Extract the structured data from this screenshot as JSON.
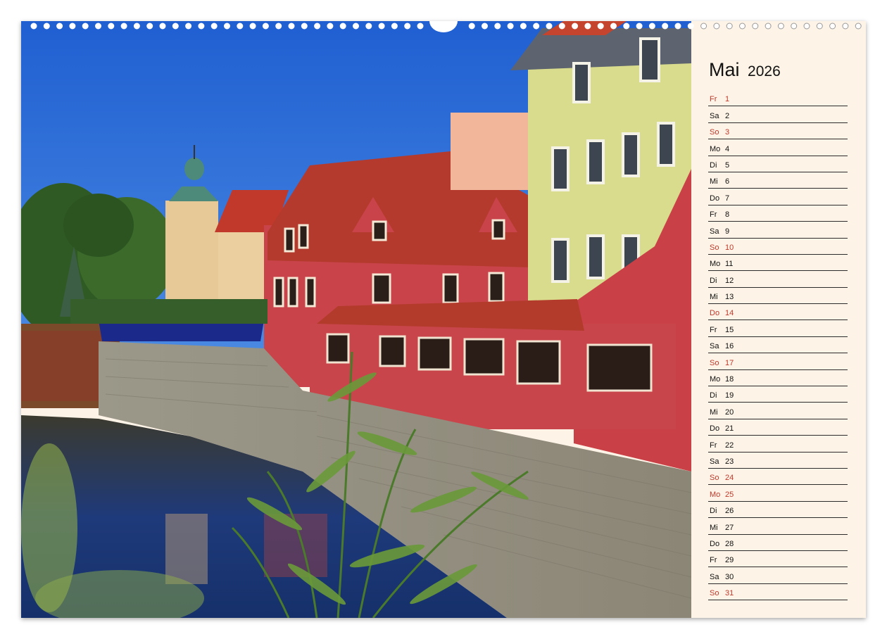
{
  "calendar": {
    "month": "Mai",
    "year": "2026",
    "holiday_color": "#c0392b",
    "days": [
      {
        "wd": "Fr",
        "num": "1",
        "holiday": true
      },
      {
        "wd": "Sa",
        "num": "2",
        "holiday": false
      },
      {
        "wd": "So",
        "num": "3",
        "holiday": true
      },
      {
        "wd": "Mo",
        "num": "4",
        "holiday": false
      },
      {
        "wd": "Di",
        "num": "5",
        "holiday": false
      },
      {
        "wd": "Mi",
        "num": "6",
        "holiday": false
      },
      {
        "wd": "Do",
        "num": "7",
        "holiday": false
      },
      {
        "wd": "Fr",
        "num": "8",
        "holiday": false
      },
      {
        "wd": "Sa",
        "num": "9",
        "holiday": false
      },
      {
        "wd": "So",
        "num": "10",
        "holiday": true
      },
      {
        "wd": "Mo",
        "num": "11",
        "holiday": false
      },
      {
        "wd": "Di",
        "num": "12",
        "holiday": false
      },
      {
        "wd": "Mi",
        "num": "13",
        "holiday": false
      },
      {
        "wd": "Do",
        "num": "14",
        "holiday": true
      },
      {
        "wd": "Fr",
        "num": "15",
        "holiday": false
      },
      {
        "wd": "Sa",
        "num": "16",
        "holiday": false
      },
      {
        "wd": "So",
        "num": "17",
        "holiday": true
      },
      {
        "wd": "Mo",
        "num": "18",
        "holiday": false
      },
      {
        "wd": "Di",
        "num": "19",
        "holiday": false
      },
      {
        "wd": "Mi",
        "num": "20",
        "holiday": false
      },
      {
        "wd": "Do",
        "num": "21",
        "holiday": false
      },
      {
        "wd": "Fr",
        "num": "22",
        "holiday": false
      },
      {
        "wd": "Sa",
        "num": "23",
        "holiday": false
      },
      {
        "wd": "So",
        "num": "24",
        "holiday": true
      },
      {
        "wd": "Mo",
        "num": "25",
        "holiday": true
      },
      {
        "wd": "Di",
        "num": "26",
        "holiday": false
      },
      {
        "wd": "Mi",
        "num": "27",
        "holiday": false
      },
      {
        "wd": "Do",
        "num": "28",
        "holiday": false
      },
      {
        "wd": "Fr",
        "num": "29",
        "holiday": false
      },
      {
        "wd": "Sa",
        "num": "30",
        "holiday": false
      },
      {
        "wd": "So",
        "num": "31",
        "holiday": true
      }
    ]
  },
  "photo": {
    "subject": "town-riverside-photo",
    "sky_color": "#2a6bd6",
    "wall_color": "#c9444a",
    "roof_color": "#b83a2c",
    "green_building_color": "#d8dc8c",
    "tower_color": "#e2c493"
  }
}
